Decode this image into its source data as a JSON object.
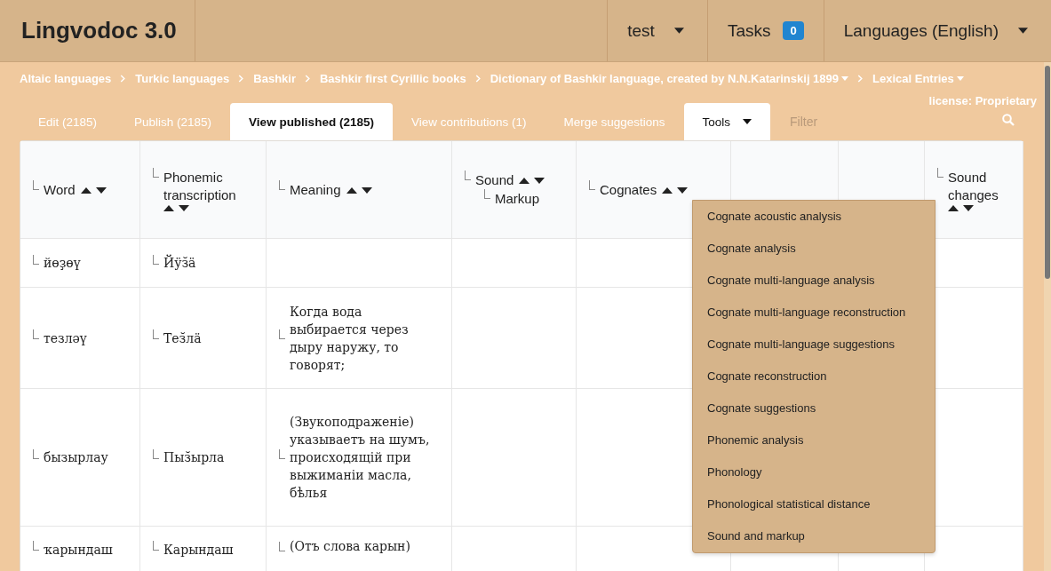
{
  "header": {
    "title": "Lingvodoc 3.0",
    "menus": [
      {
        "kind": "dropdown",
        "label": "test"
      },
      {
        "kind": "badge",
        "label": "Tasks",
        "count": "0"
      },
      {
        "kind": "dropdown",
        "label": "Languages (English)"
      }
    ]
  },
  "breadcrumbs": [
    {
      "label": "Altaic languages",
      "dropdown": false
    },
    {
      "label": "Turkic languages",
      "dropdown": false
    },
    {
      "label": "Bashkir",
      "dropdown": false
    },
    {
      "label": "Bashkir first Cyrillic books",
      "dropdown": false
    },
    {
      "label": "Dictionary of Bashkir language, created by N.N.Katarinskij 1899",
      "dropdown": true
    },
    {
      "label": "Lexical Entries",
      "dropdown": true
    }
  ],
  "tabs": [
    {
      "label": "Edit (2185)",
      "selected": false,
      "expanded": false
    },
    {
      "label": "Publish (2185)",
      "selected": false,
      "expanded": false
    },
    {
      "label": "View published (2185)",
      "selected": true,
      "expanded": false
    },
    {
      "label": "View contributions (1)",
      "selected": false,
      "expanded": false
    },
    {
      "label": "Merge suggestions",
      "selected": false,
      "expanded": false
    },
    {
      "label": "Tools",
      "selected": false,
      "expanded": true,
      "kind": "dropdown"
    }
  ],
  "filter": {
    "placeholder": "Filter"
  },
  "license": "license: Proprietary",
  "tools_menu": {
    "items": [
      "Cognate acoustic analysis",
      "Cognate analysis",
      "Cognate multi-language analysis",
      "Cognate multi-language reconstruction",
      "Cognate multi-language suggestions",
      "Cognate reconstruction",
      "Cognate suggestions",
      "Phonemic analysis",
      "Phonology",
      "Phonological statistical distance",
      "Sound and markup"
    ]
  },
  "table": {
    "columns": [
      {
        "kind": "text",
        "label": "Word",
        "sortable": true
      },
      {
        "kind": "text",
        "label": "Phonemic transcription",
        "sortable": true
      },
      {
        "kind": "text",
        "label": "Meaning",
        "sortable": true
      },
      {
        "kind": "text",
        "label": "Sound",
        "sortable": true,
        "children": [
          {
            "label": "Markup",
            "sortable": false
          }
        ]
      },
      {
        "kind": "text",
        "label": "Cognates",
        "sortable": true
      },
      {
        "kind": "covered"
      },
      {
        "kind": "covered"
      },
      {
        "kind": "text",
        "label": "Sound changes",
        "sortable": true
      }
    ],
    "rows": [
      {
        "cells": [
          "йөҙөү",
          "Йӱз̆ä"
        ]
      },
      {
        "cells": [
          "тезләү",
          "Тез̆лä",
          "Когда вода выбирается через дыру наружу, то говорят;"
        ]
      },
      {
        "cells": [
          "бызырлау",
          "Пыз̆ырла",
          "(Звукоподраженіе) указываетъ на шумъ, происходящій при выжиманіи масла, бѣлья"
        ]
      },
      {
        "cells": [
          "ҡарындаш",
          "Карындаш",
          "(Отъ слова карын)"
        ]
      }
    ]
  }
}
